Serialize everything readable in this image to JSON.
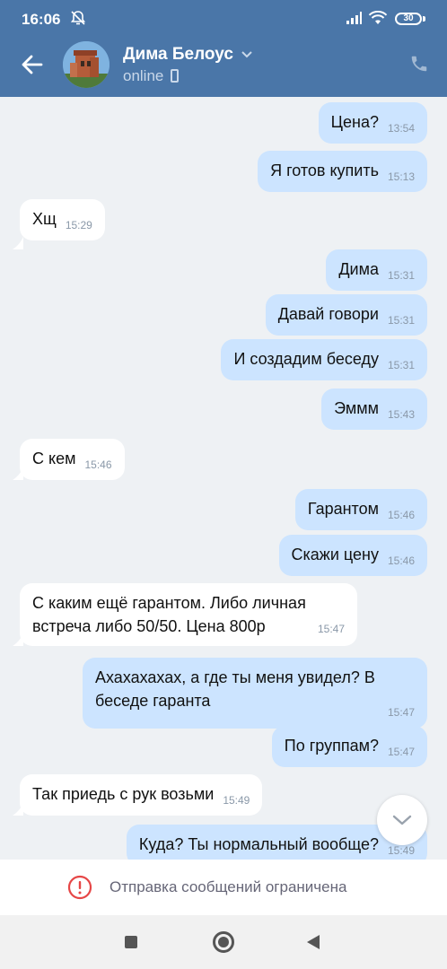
{
  "status": {
    "time": "16:06",
    "battery": "30"
  },
  "header": {
    "name": "Дима Белоус",
    "status": "online"
  },
  "messages": [
    {
      "dir": "out",
      "text": "Цена?",
      "time": "13:54"
    },
    {
      "dir": "out",
      "text": "Я готов купить",
      "time": "15:13"
    },
    {
      "dir": "in",
      "text": "Хщ",
      "time": "15:29"
    },
    {
      "dir": "out",
      "text": "Дима",
      "time": "15:31"
    },
    {
      "dir": "out",
      "text": "Давай говори",
      "time": "15:31"
    },
    {
      "dir": "out",
      "text": "И создадим беседу",
      "time": "15:31"
    },
    {
      "dir": "out",
      "text": "Эммм",
      "time": "15:43"
    },
    {
      "dir": "in",
      "text": "С кем",
      "time": "15:46"
    },
    {
      "dir": "out",
      "text": "Гарантом",
      "time": "15:46"
    },
    {
      "dir": "out",
      "text": "Скажи цену",
      "time": "15:46"
    },
    {
      "dir": "in",
      "text": "С каким ещё гарантом. Либо личная встреча либо 50/50. Цена 800р",
      "time": "15:47"
    },
    {
      "dir": "out",
      "text": "Ахахахахах, а где ты меня увидел?  В беседе гаранта",
      "time": "15:47"
    },
    {
      "dir": "out",
      "text": "По группам?",
      "time": "15:47"
    },
    {
      "dir": "in",
      "text": "Так приедь с рук возьми",
      "time": "15:49"
    },
    {
      "dir": "out",
      "text": "Куда? Ты нормальный вообще?",
      "time": "15:49"
    }
  ],
  "restriction": {
    "text": "Отправка сообщений ограничена"
  }
}
